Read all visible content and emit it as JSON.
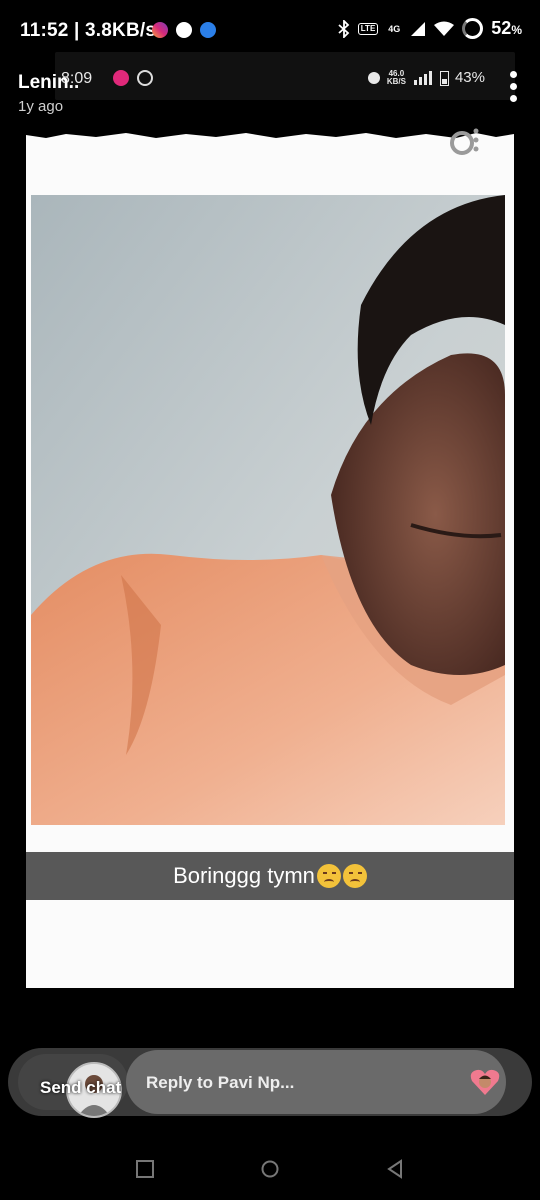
{
  "status_bar": {
    "time": "11:52 | 3.8KB/s",
    "battery": "52",
    "battery_unit": "%",
    "lte_badge": "LTE",
    "net_badge": "4G"
  },
  "story": {
    "name": "Lenin..",
    "age": "1y ago"
  },
  "inner_status": {
    "time": "8:09",
    "speed_top": "46.0",
    "speed_bottom": "KB/S",
    "battery": "43%"
  },
  "card": {
    "caption": "Boringgg tymn"
  },
  "reply_bar": {
    "send_label": "Send chat",
    "placeholder": "Reply to Pavi Np..."
  },
  "colors": {
    "background": "#000000",
    "caption_bar": "#585858",
    "reply_field": "#6a6a6a",
    "shirt": "#e89a72"
  },
  "icons": [
    "instagram-icon",
    "settings-icon",
    "message-icon",
    "bluetooth-icon",
    "signal-icon",
    "wifi-icon",
    "battery-icon",
    "more-icon",
    "rotate-icon",
    "heart-sticker-icon",
    "nav-recents-icon",
    "nav-home-icon",
    "nav-back-icon"
  ]
}
